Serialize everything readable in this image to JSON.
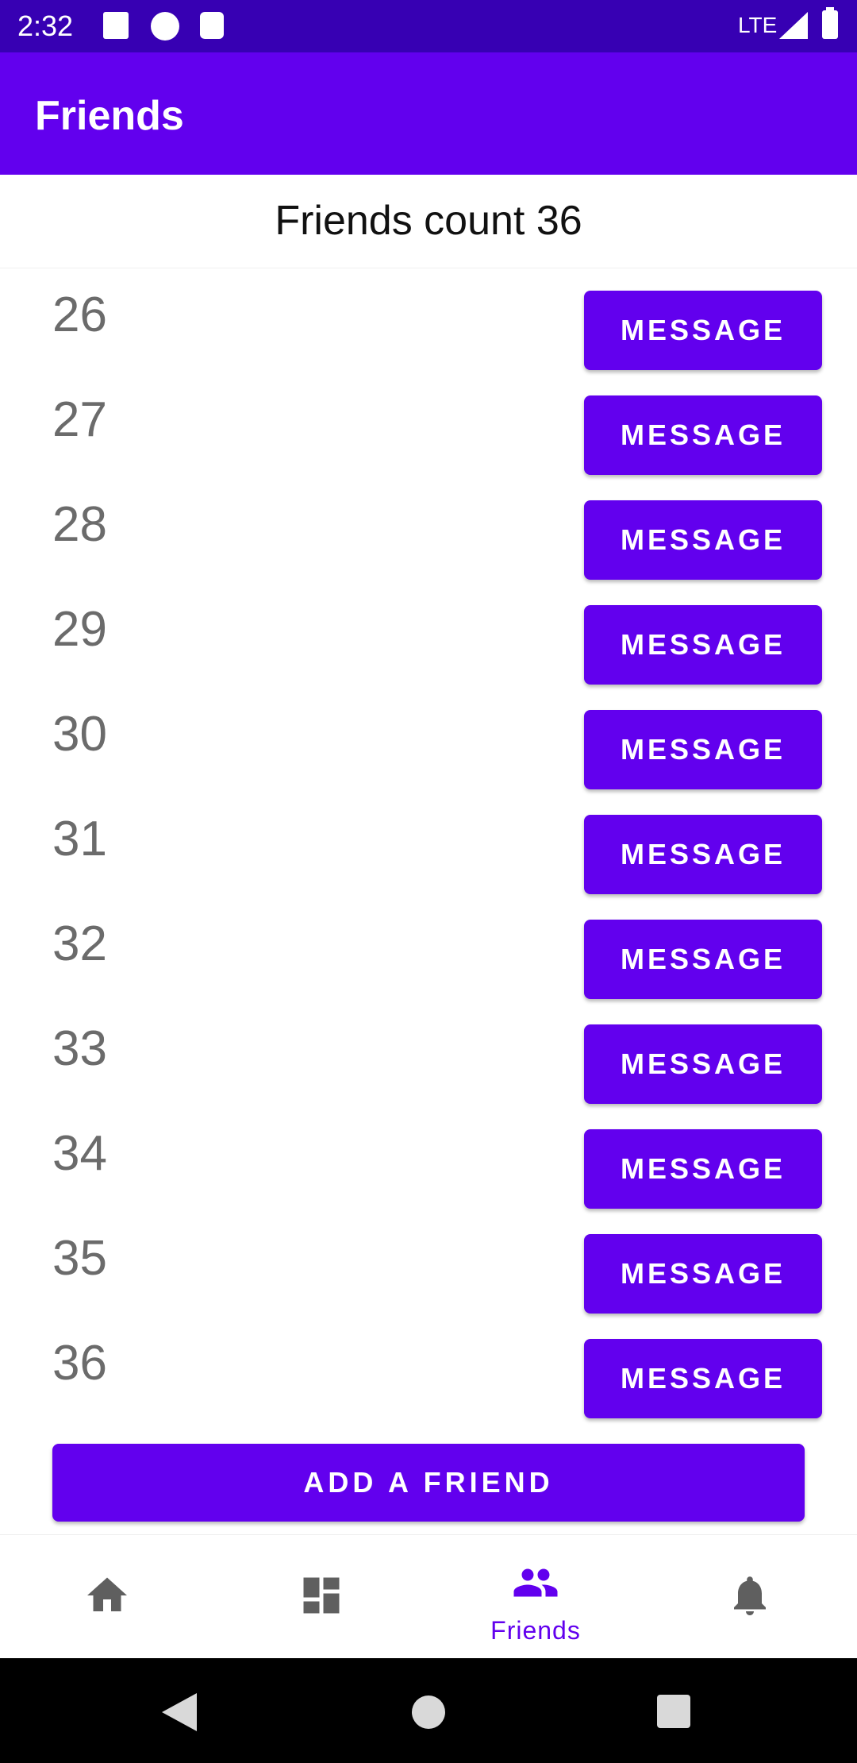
{
  "status_bar": {
    "time": "2:32",
    "network": "LTE",
    "icons": [
      "keyboard-a-icon",
      "circle-app-icon",
      "sd-card-icon",
      "signal-icon",
      "battery-icon"
    ]
  },
  "app_bar": {
    "title": "Friends"
  },
  "friends_count_text": "Friends count 36",
  "friends": [
    {
      "label": "26",
      "button": "MESSAGE"
    },
    {
      "label": "27",
      "button": "MESSAGE"
    },
    {
      "label": "28",
      "button": "MESSAGE"
    },
    {
      "label": "29",
      "button": "MESSAGE"
    },
    {
      "label": "30",
      "button": "MESSAGE"
    },
    {
      "label": "31",
      "button": "MESSAGE"
    },
    {
      "label": "32",
      "button": "MESSAGE"
    },
    {
      "label": "33",
      "button": "MESSAGE"
    },
    {
      "label": "34",
      "button": "MESSAGE"
    },
    {
      "label": "35",
      "button": "MESSAGE"
    },
    {
      "label": "36",
      "button": "MESSAGE"
    }
  ],
  "add_friend_label": "ADD A FRIEND",
  "bottom_nav": {
    "items": [
      {
        "icon": "home-icon",
        "label": ""
      },
      {
        "icon": "dashboard-icon",
        "label": ""
      },
      {
        "icon": "people-icon",
        "label": "Friends",
        "active": true
      },
      {
        "icon": "bell-icon",
        "label": ""
      }
    ]
  },
  "colors": {
    "primary": "#6200EE",
    "primary_dark": "#3700B3",
    "inactive_icon": "#5f5f5f"
  }
}
